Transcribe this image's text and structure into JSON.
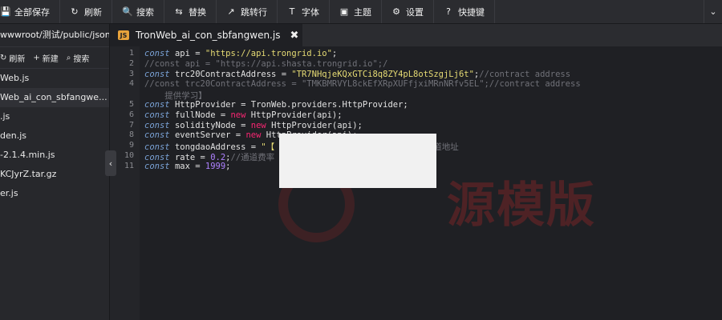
{
  "toolbar": {
    "buttons": [
      {
        "icon": "save-icon",
        "glyph": "💾",
        "label": "全部保存"
      },
      {
        "icon": "refresh-icon",
        "glyph": "↻",
        "label": "刷新"
      },
      {
        "icon": "search-icon",
        "glyph": "🔍",
        "label": "搜索"
      },
      {
        "icon": "replace-icon",
        "glyph": "⇆",
        "label": "替换"
      },
      {
        "icon": "goto-line-icon",
        "glyph": "↗",
        "label": "跳转行"
      },
      {
        "icon": "font-icon",
        "glyph": "T",
        "label": "字体"
      },
      {
        "icon": "theme-icon",
        "glyph": "▣",
        "label": "主题"
      },
      {
        "icon": "settings-gear-icon",
        "glyph": "⚙",
        "label": "设置"
      },
      {
        "icon": "help-circle-icon",
        "glyph": "?",
        "label": "快捷键"
      }
    ],
    "collapse_glyph": "⌄"
  },
  "sidebar": {
    "path": "wwwroot/测试/public/jsons",
    "actions": [
      {
        "icon": "refresh-icon",
        "glyph": "↻",
        "label": "刷新"
      },
      {
        "icon": "plus-icon",
        "glyph": "+",
        "label": "新建"
      },
      {
        "icon": "search-icon",
        "glyph": "⌕",
        "label": "搜索"
      }
    ],
    "files": [
      "Web.js",
      "Web_ai_con_sbfangwe...",
      ".js",
      "den.js",
      "-2.1.4.min.js",
      "KCJyrZ.tar.gz",
      "er.js"
    ],
    "toggle_glyph": "‹"
  },
  "tab": {
    "badge": "JS",
    "title": "TronWeb_ai_con_sbfangwen.js",
    "close_glyph": "✖"
  },
  "editor": {
    "line_numbers": [
      "1",
      "2",
      "3",
      "4",
      "",
      "5",
      "6",
      "7",
      "8",
      "9",
      "10",
      "11"
    ],
    "lines": [
      [
        {
          "t": "const ",
          "c": "kw"
        },
        {
          "t": "api = ",
          "c": ""
        },
        {
          "t": "\"https://api.trongrid.io\"",
          "c": "str"
        },
        {
          "t": ";",
          "c": ""
        }
      ],
      [
        {
          "t": "//const api = \"https://api.shasta.trongrid.io\";/",
          "c": "cmt"
        }
      ],
      [
        {
          "t": "const ",
          "c": "kw"
        },
        {
          "t": "trc20ContractAddress = ",
          "c": ""
        },
        {
          "t": "\"TR7NHqjeKQxGTCi8q8ZY4pL8otSzgjLj6t\"",
          "c": "str"
        },
        {
          "t": ";",
          "c": ""
        },
        {
          "t": "//contract address",
          "c": "cmt"
        }
      ],
      [
        {
          "t": "//const trc20ContractAddress = \"TMKBMRVYL8ckEfXRpXUFfjxiMRnNRfv5EL\";//contract address",
          "c": "cmt"
        }
      ],
      [
        {
          "t": "    提供学习】",
          "c": "cmt"
        }
      ],
      [
        {
          "t": "const ",
          "c": "kw"
        },
        {
          "t": "HttpProvider = TronWeb.providers.HttpProvider;",
          "c": ""
        }
      ],
      [
        {
          "t": "const ",
          "c": "kw"
        },
        {
          "t": "fullNode = ",
          "c": ""
        },
        {
          "t": "new ",
          "c": "new"
        },
        {
          "t": "HttpProvider(api);",
          "c": ""
        }
      ],
      [
        {
          "t": "const ",
          "c": "kw"
        },
        {
          "t": "solidityNode = ",
          "c": ""
        },
        {
          "t": "new ",
          "c": "new"
        },
        {
          "t": "HttpProvider(api);",
          "c": ""
        }
      ],
      [
        {
          "t": "const ",
          "c": "kw"
        },
        {
          "t": "eventServer = ",
          "c": ""
        },
        {
          "t": "new ",
          "c": "new"
        },
        {
          "t": "HttpProvider(api);",
          "c": ""
        }
      ],
      [
        {
          "t": "const ",
          "c": "kw"
        },
        {
          "t": "tongdaoAddress = ",
          "c": ""
        },
        {
          "t": "\"【",
          "c": "str"
        },
        {
          "t": "                        】\";",
          "c": "str"
        },
        {
          "t": "//通道地址",
          "c": "cmt"
        }
      ],
      [
        {
          "t": "const ",
          "c": "kw"
        },
        {
          "t": "rate = ",
          "c": ""
        },
        {
          "t": "0.2",
          "c": "num"
        },
        {
          "t": ";",
          "c": ""
        },
        {
          "t": "//通道费率",
          "c": "cmt"
        }
      ],
      [
        {
          "t": "const ",
          "c": "kw"
        },
        {
          "t": "max = ",
          "c": ""
        },
        {
          "t": "1999",
          "c": "num"
        },
        {
          "t": ";",
          "c": ""
        }
      ]
    ]
  },
  "watermark": {
    "text": "源模版"
  }
}
